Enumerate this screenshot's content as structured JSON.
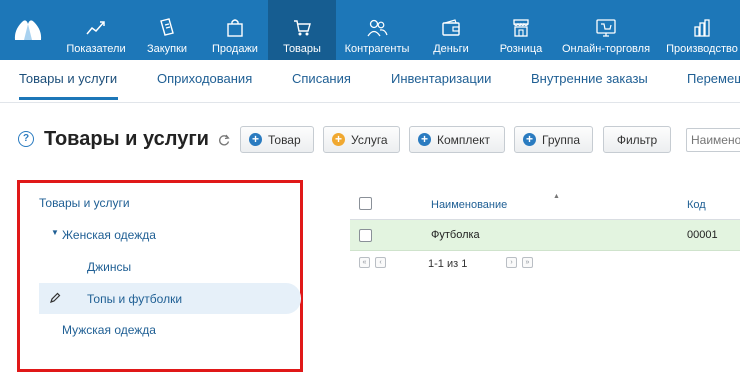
{
  "nav": {
    "items": [
      {
        "label": "Показатели",
        "icon": "chart-icon"
      },
      {
        "label": "Закупки",
        "icon": "purchase-icon"
      },
      {
        "label": "Продажи",
        "icon": "bag-icon"
      },
      {
        "label": "Товары",
        "icon": "cart-icon"
      },
      {
        "label": "Контрагенты",
        "icon": "users-icon"
      },
      {
        "label": "Деньги",
        "icon": "wallet-icon"
      },
      {
        "label": "Розница",
        "icon": "store-icon"
      },
      {
        "label": "Онлайн-торговля",
        "icon": "online-store-icon"
      },
      {
        "label": "Производство",
        "icon": "factory-icon"
      }
    ],
    "active": "Товары"
  },
  "subtabs": [
    "Товары и услуги",
    "Оприходования",
    "Списания",
    "Инвентаризации",
    "Внутренние заказы",
    "Перемещения"
  ],
  "page": {
    "help": "?",
    "title": "Товары и услуги"
  },
  "toolbar": {
    "product": "Товар",
    "service": "Услуга",
    "kit": "Комплект",
    "group": "Группа",
    "filter": "Фильтр",
    "search_placeholder": "Наименование"
  },
  "tree": {
    "root": "Товары и услуги",
    "women": "Женская одежда",
    "jeans": "Джинсы",
    "tops": "Топы и футболки",
    "men": "Мужская одежда"
  },
  "table": {
    "headers": {
      "name": "Наименование",
      "code": "Код"
    },
    "rows": [
      {
        "name": "Футболка",
        "code": "00001"
      }
    ],
    "pager": "1-1 из 1"
  },
  "colors": {
    "nav": "#1d77b8",
    "nav_active": "#165d91",
    "highlight": "#e01818",
    "row_selected": "#e3f4e0"
  }
}
